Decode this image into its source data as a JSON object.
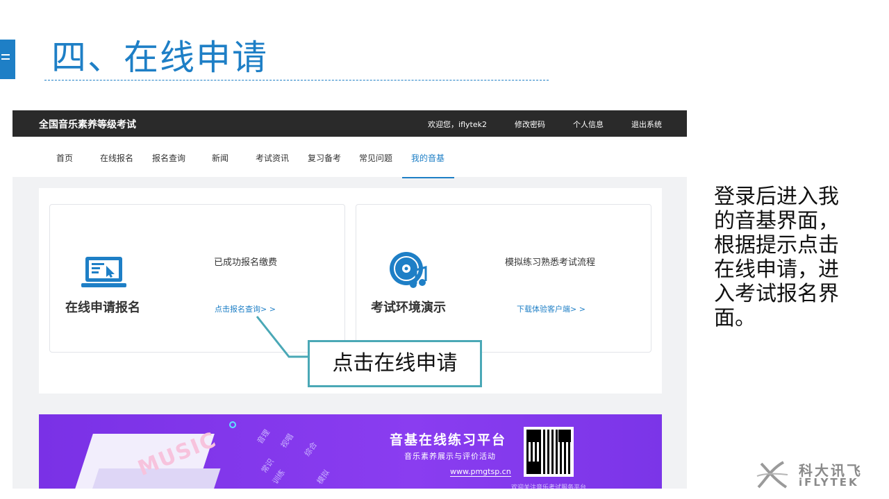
{
  "slide": {
    "title": "四、在线申请",
    "description": "登录后进入我的音基界面，根据提示点击在线申请，进入考试报名界面。"
  },
  "site": {
    "name": "全国音乐素养等级考试",
    "welcome": "欢迎您，iflytek2",
    "change_password": "修改密码",
    "profile": "个人信息",
    "logout": "退出系统"
  },
  "nav": {
    "items": [
      "首页",
      "在线报名",
      "报名查询",
      "新闻",
      "考试资讯",
      "复习备考",
      "常见问题",
      "我的音基"
    ],
    "active": "我的音基"
  },
  "cards": {
    "apply": {
      "title": "在线申请报名",
      "status": "已成功报名缴费",
      "link": "点击报名查询> >"
    },
    "demo": {
      "title": "考试环境演示",
      "status": "模拟练习熟悉考试流程",
      "link": "下载体验客户端> >"
    }
  },
  "callout": {
    "text": "点击在线申请"
  },
  "banner": {
    "music_text": "MUSIC",
    "tags": [
      "音理",
      "常识",
      "视唱",
      "训练",
      "综合",
      "模拟"
    ],
    "title": "音基在线练习平台",
    "subtitle": "音乐素养展示与评价活动",
    "url": "www.pmgtsp.cn",
    "footer": "欢迎关注音乐考试服务平台"
  },
  "logo": {
    "cn": "科大讯飞",
    "en": "iFLYTEK"
  },
  "colors": {
    "accent": "#1e7fc6",
    "callout": "#4aa8b6",
    "banner": "#7a31e6",
    "topbar": "#2a2a2a"
  }
}
